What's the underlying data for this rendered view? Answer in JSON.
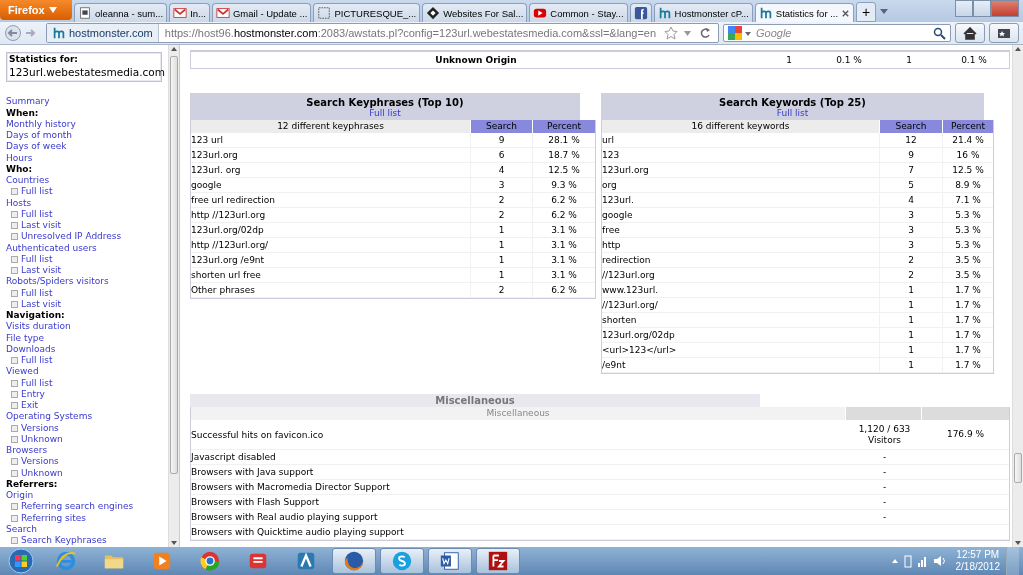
{
  "browser": {
    "menu_button": "Firefox",
    "tabs": [
      {
        "title": "oleanna - sum...",
        "kind": "page",
        "selected": false
      },
      {
        "title": "In...",
        "kind": "mail",
        "selected": false
      },
      {
        "title": "Gmail - Update ...",
        "kind": "mail",
        "selected": false
      },
      {
        "title": "PICTURESQUE_...",
        "kind": "dotted",
        "selected": false
      },
      {
        "title": "Websites For Sal...",
        "kind": "diamond",
        "selected": false
      },
      {
        "title": "Common - Stay...",
        "kind": "video",
        "selected": false
      },
      {
        "kind": "social",
        "selected": false
      },
      {
        "title": "Hostmonster cP...",
        "kind": "host",
        "selected": false
      },
      {
        "title": "Statistics for ...",
        "kind": "host",
        "selected": true
      }
    ],
    "new_tab": "+",
    "site_id": "hostmonster.com",
    "url": "https://host96.**hostmonster.com**:2083/awstats.pl?config=123url.webestatesmedia.com&ssl=&lang=en",
    "search_placeholder": "Google"
  },
  "sidebar": {
    "stats_label": "Statistics for:",
    "domain": "123url.webestatesmedia.com",
    "items": [
      {
        "label": "Summary",
        "kind": "link"
      },
      {
        "label": "When:",
        "kind": "heading"
      },
      {
        "label": "Monthly history",
        "kind": "link"
      },
      {
        "label": "Days of month",
        "kind": "link"
      },
      {
        "label": "Days of week",
        "kind": "link"
      },
      {
        "label": "Hours",
        "kind": "link"
      },
      {
        "label": "Who:",
        "kind": "heading"
      },
      {
        "label": "Countries",
        "kind": "link",
        "children": [
          {
            "label": "Full list"
          }
        ]
      },
      {
        "label": "Hosts",
        "kind": "link",
        "children": [
          {
            "label": "Full list"
          },
          {
            "label": "Last visit"
          },
          {
            "label": "Unresolved IP Address"
          }
        ]
      },
      {
        "label": "Authenticated users",
        "kind": "link",
        "children": [
          {
            "label": "Full list"
          },
          {
            "label": "Last visit"
          }
        ]
      },
      {
        "label": "Robots/Spiders visitors",
        "kind": "link",
        "children": [
          {
            "label": "Full list"
          },
          {
            "label": "Last visit"
          }
        ]
      },
      {
        "label": "Navigation:",
        "kind": "heading"
      },
      {
        "label": "Visits duration",
        "kind": "link"
      },
      {
        "label": "File type",
        "kind": "link"
      },
      {
        "label": "Downloads",
        "kind": "link",
        "children": [
          {
            "label": "Full list"
          }
        ]
      },
      {
        "label": "Viewed",
        "kind": "link",
        "children": [
          {
            "label": "Full list"
          },
          {
            "label": "Entry"
          },
          {
            "label": "Exit"
          }
        ]
      },
      {
        "label": "Operating Systems",
        "kind": "link",
        "children": [
          {
            "label": "Versions"
          },
          {
            "label": "Unknown"
          }
        ]
      },
      {
        "label": "Browsers",
        "kind": "link",
        "children": [
          {
            "label": "Versions"
          },
          {
            "label": "Unknown"
          }
        ]
      },
      {
        "label": "Referrers:",
        "kind": "heading"
      },
      {
        "label": "Origin",
        "kind": "link",
        "children": [
          {
            "label": "Referring search engines"
          },
          {
            "label": "Referring sites"
          }
        ]
      },
      {
        "label": "Search",
        "kind": "link",
        "children": [
          {
            "label": "Search Keyphrases"
          }
        ]
      }
    ]
  },
  "origin_row": {
    "label": "Unknown Origin",
    "values": [
      "1",
      "0.1 %",
      "1",
      "0.1 %"
    ]
  },
  "keyphrases": {
    "title": "Search Keyphrases (Top 10)",
    "link": "Full list",
    "columns": [
      "12 different keyphrases",
      "Search",
      "Percent"
    ],
    "rows": [
      [
        "123 url",
        "9",
        "28.1 %"
      ],
      [
        "123url.org",
        "6",
        "18.7 %"
      ],
      [
        "123url. org",
        "4",
        "12.5 %"
      ],
      [
        "google",
        "3",
        "9.3 %"
      ],
      [
        "free url redirection",
        "2",
        "6.2 %"
      ],
      [
        "http //123url.org",
        "2",
        "6.2 %"
      ],
      [
        "123url.org/02dp",
        "1",
        "3.1 %"
      ],
      [
        "http //123url.org/",
        "1",
        "3.1 %"
      ],
      [
        "123url.org /e9nt",
        "1",
        "3.1 %"
      ],
      [
        "shorten url free",
        "1",
        "3.1 %"
      ],
      [
        "Other phrases",
        "2",
        "6.2 %"
      ]
    ]
  },
  "keywords": {
    "title": "Search Keywords (Top 25)",
    "link": "Full list",
    "columns": [
      "16 different keywords",
      "Search",
      "Percent"
    ],
    "rows": [
      [
        "url",
        "12",
        "21.4 %"
      ],
      [
        "123",
        "9",
        "16 %"
      ],
      [
        "123url.org",
        "7",
        "12.5 %"
      ],
      [
        "org",
        "5",
        "8.9 %"
      ],
      [
        "123url.",
        "4",
        "7.1 %"
      ],
      [
        "google",
        "3",
        "5.3 %"
      ],
      [
        "free",
        "3",
        "5.3 %"
      ],
      [
        "http",
        "3",
        "5.3 %"
      ],
      [
        "redirection",
        "2",
        "3.5 %"
      ],
      [
        "//123url.org",
        "2",
        "3.5 %"
      ],
      [
        "www.123url.",
        "1",
        "1.7 %"
      ],
      [
        "//123url.org/",
        "1",
        "1.7 %"
      ],
      [
        "shorten",
        "1",
        "1.7 %"
      ],
      [
        "123url.org/02dp",
        "1",
        "1.7 %"
      ],
      [
        "<url>123</url>",
        "1",
        "1.7 %"
      ],
      [
        "/e9nt",
        "1",
        "1.7 %"
      ]
    ]
  },
  "misc": {
    "title": "Miscellaneous",
    "column": "Miscellaneous",
    "rows": [
      {
        "label": "Successful hits on favicon.ico",
        "value": "1,120 / 633",
        "value_2": "Visitors",
        "percent": "176.9 %"
      },
      {
        "label": "Javascript disabled",
        "value": "-"
      },
      {
        "label": "Browsers with Java support",
        "value": "-"
      },
      {
        "label": "Browsers with Macromedia Director Support",
        "value": "-"
      },
      {
        "label": "Browsers with Flash Support",
        "value": "-"
      },
      {
        "label": "Browsers with Real audio playing support",
        "value": "-"
      },
      {
        "label": "Browsers with Quicktime audio playing support"
      }
    ]
  },
  "taskbar": {
    "apps": [
      {
        "kind": "ie",
        "selected": false
      },
      {
        "kind": "folder",
        "selected": false
      },
      {
        "kind": "media",
        "selected": false
      },
      {
        "kind": "chrome",
        "selected": false
      },
      {
        "kind": "red",
        "selected": false
      },
      {
        "kind": "blue",
        "selected": false
      },
      {
        "kind": "firefox",
        "selected": true
      },
      {
        "kind": "skype",
        "selected": true
      },
      {
        "kind": "word",
        "selected": true
      },
      {
        "kind": "filezilla",
        "selected": true
      }
    ],
    "time": "12:57 PM",
    "date": "2/18/2012"
  }
}
